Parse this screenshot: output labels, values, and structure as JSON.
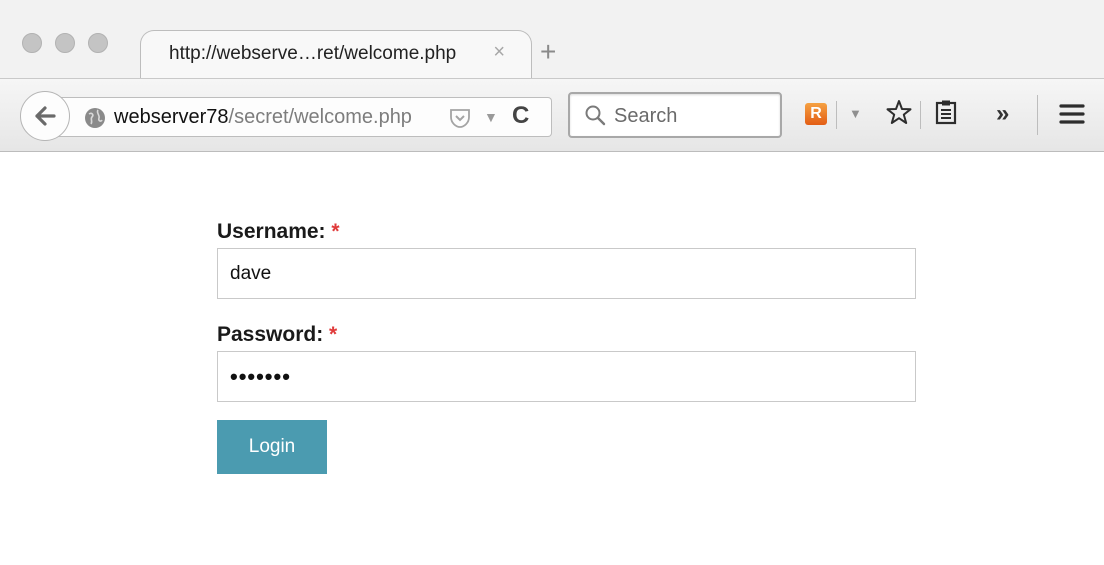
{
  "tab": {
    "title": "http://webserve…ret/welcome.php",
    "close_glyph": "×",
    "new_tab_glyph": "+"
  },
  "urlbar": {
    "host": "webserver78",
    "path": "/secret/welcome.php"
  },
  "search": {
    "placeholder": "Search"
  },
  "toolbar": {
    "rss_glyph": "R",
    "overflow_glyph": "»",
    "reload_glyph": "C"
  },
  "form": {
    "username_label": "Username:",
    "username_required": "*",
    "username_value": "dave",
    "password_label": "Password:",
    "password_required": "*",
    "password_mask": "•••••••",
    "login_label": "Login"
  },
  "colors": {
    "button_bg": "#4b9bb0",
    "required": "#e03a3a"
  }
}
